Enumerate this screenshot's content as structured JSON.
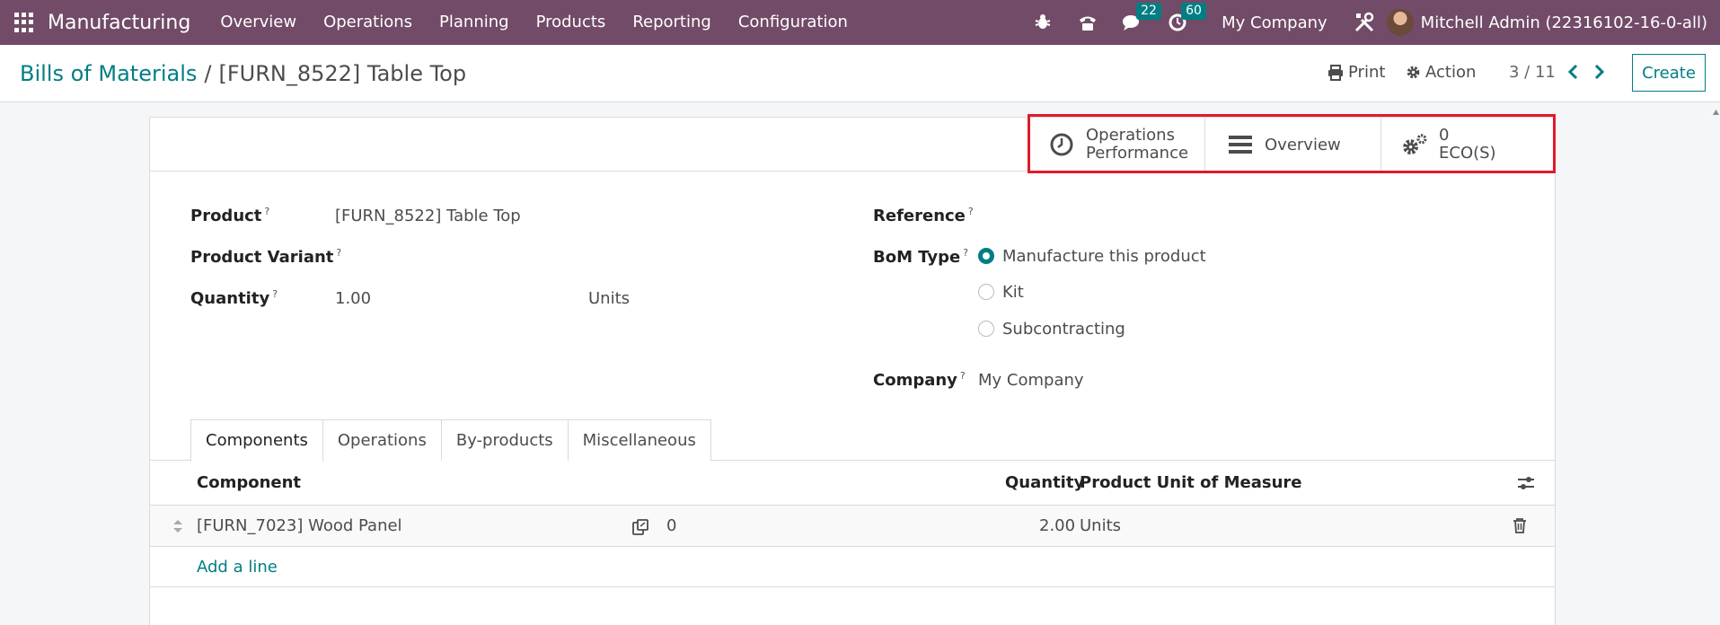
{
  "navbar": {
    "app_name": "Manufacturing",
    "menu": [
      "Overview",
      "Operations",
      "Planning",
      "Products",
      "Reporting",
      "Configuration"
    ],
    "chat_count": "22",
    "activity_count": "60",
    "company": "My Company",
    "user": "Mitchell Admin (22316102-16-0-all)",
    "bg_color": "#714b67"
  },
  "control": {
    "breadcrumb_parent": "Bills of Materials",
    "breadcrumb_sep": "/",
    "breadcrumb_current": "[FURN_8522] Table Top",
    "print_label": "Print",
    "action_label": "Action",
    "pager": "3 / 11",
    "create_label": "Create"
  },
  "smart_buttons": {
    "ops_perf_line1": "Operations",
    "ops_perf_line2": "Performance",
    "overview": "Overview",
    "eco_count": "0",
    "eco_label": "ECO(S)"
  },
  "form": {
    "product_label": "Product",
    "product_value": "[FURN_8522] Table Top",
    "variant_label": "Product Variant",
    "quantity_label": "Quantity",
    "quantity_value": "1.00",
    "quantity_uom": "Units",
    "reference_label": "Reference",
    "bom_type_label": "BoM Type",
    "bom_types": [
      "Manufacture this product",
      "Kit",
      "Subcontracting"
    ],
    "bom_type_selected": "Manufacture this product",
    "company_label": "Company",
    "company_value": "My Company",
    "help_mark": "?"
  },
  "tabs": [
    "Components",
    "Operations",
    "By-products",
    "Miscellaneous"
  ],
  "components": {
    "headers": {
      "component": "Component",
      "quantity": "Quantity",
      "uom": "Product Unit of Measure"
    },
    "rows": [
      {
        "component": "[FURN_7023] Wood Panel",
        "forecast": "0",
        "quantity": "2.00",
        "uom": "Units"
      }
    ],
    "add_line": "Add a line"
  },
  "colors": {
    "accent": "#017e84",
    "highlight": "#e3192a"
  }
}
